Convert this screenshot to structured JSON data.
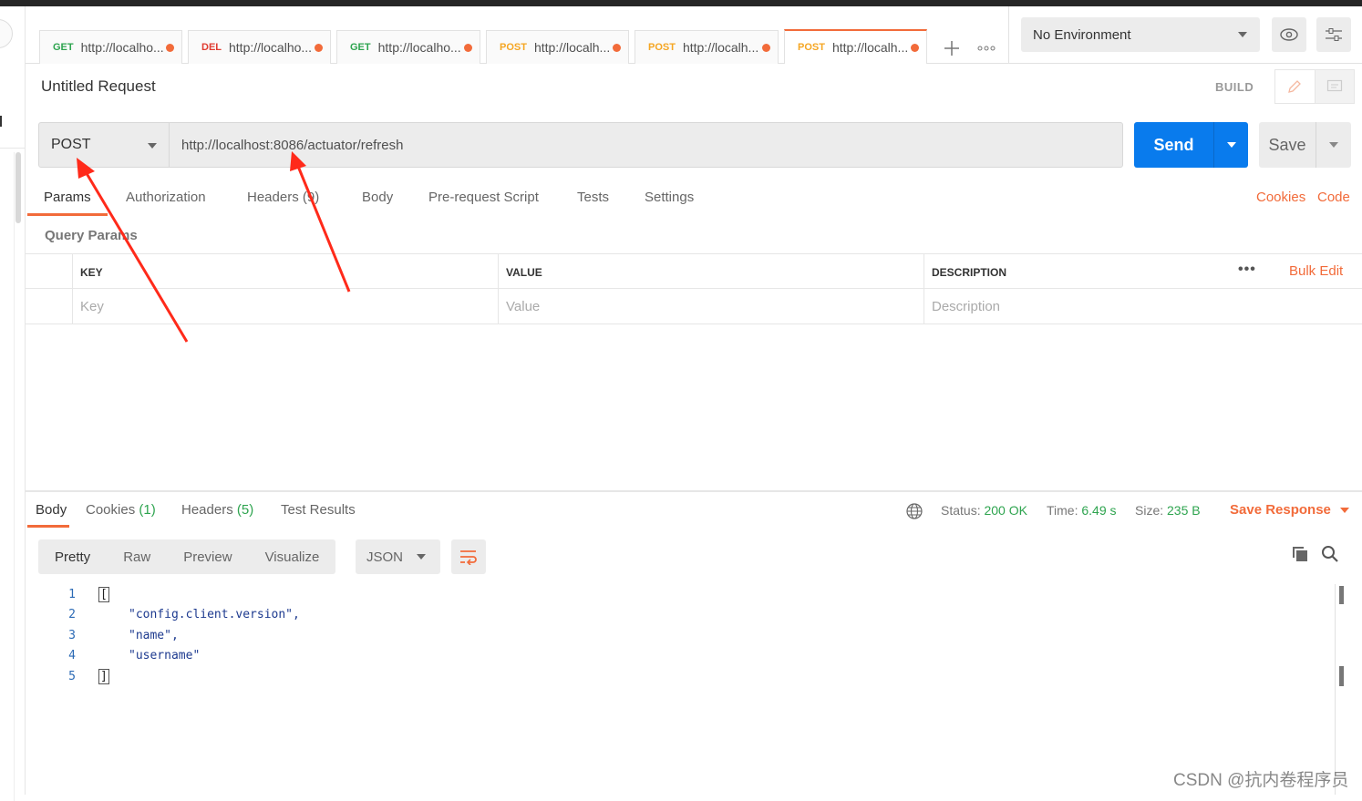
{
  "tabs": [
    {
      "method": "GET",
      "url": "http://localho..."
    },
    {
      "method": "DEL",
      "url": "http://localho..."
    },
    {
      "method": "GET",
      "url": "http://localho..."
    },
    {
      "method": "POST",
      "url": "http://localh..."
    },
    {
      "method": "POST",
      "url": "http://localh..."
    },
    {
      "method": "POST",
      "url": "http://localh..."
    }
  ],
  "environment": {
    "selected": "No Environment"
  },
  "request": {
    "title": "Untitled Request",
    "build_label": "BUILD",
    "method": "POST",
    "url": "http://localhost:8086/actuator/refresh",
    "send_label": "Send",
    "save_label": "Save"
  },
  "request_tabs": {
    "items": [
      "Params",
      "Authorization",
      "Headers (9)",
      "Body",
      "Pre-request Script",
      "Tests",
      "Settings"
    ],
    "cookies": "Cookies",
    "code": "Code",
    "active": "Params"
  },
  "query_params": {
    "label": "Query Params",
    "headers": [
      "KEY",
      "VALUE",
      "DESCRIPTION"
    ],
    "bulk_edit": "Bulk Edit",
    "placeholders": {
      "key": "Key",
      "value": "Value",
      "description": "Description"
    }
  },
  "response": {
    "tabs": {
      "body": "Body",
      "cookies": "Cookies",
      "cookies_count": "(1)",
      "headers": "Headers",
      "headers_count": "(5)",
      "tests": "Test Results"
    },
    "status_label": "Status:",
    "status_value": "200 OK",
    "time_label": "Time:",
    "time_value": "6.49 s",
    "size_label": "Size:",
    "size_value": "235 B",
    "save_response": "Save Response",
    "view_modes": [
      "Pretty",
      "Raw",
      "Preview",
      "Visualize"
    ],
    "format": "JSON",
    "body_lines": [
      {
        "n": "1",
        "text": "["
      },
      {
        "n": "2",
        "text": "\"config.client.version\","
      },
      {
        "n": "3",
        "text": "\"name\","
      },
      {
        "n": "4",
        "text": "\"username\""
      },
      {
        "n": "5",
        "text": "]"
      }
    ]
  },
  "watermark": "CSDN @抗内卷程序员",
  "colors": {
    "accent": "#f26b3a",
    "send": "#097bed",
    "get": "#2ea44f",
    "del": "#e03c31",
    "post": "#f5a623",
    "annotation_arrow": "#ff2a1a"
  }
}
